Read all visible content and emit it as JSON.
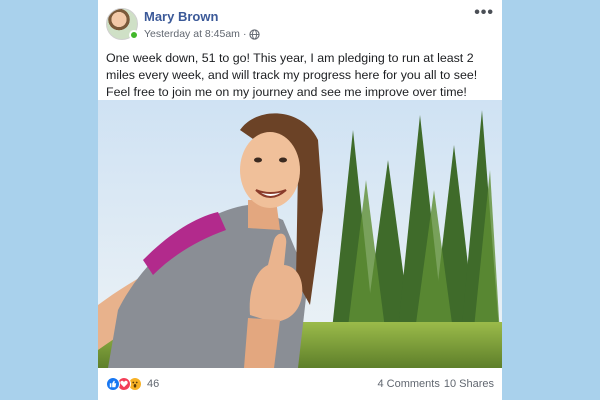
{
  "post": {
    "author": "Mary Brown",
    "timestamp": "Yesterday at 8:45am",
    "separator": "·",
    "privacy_icon": "globe-icon",
    "more_icon": "•••",
    "text": "One week down, 51 to go! This year, I am pledging to run at least 2 miles every week, and will track my progress here for you all to see! Feel free to join me on my journey and see me improve over time!",
    "photo_subject": "woman-running-selfie"
  },
  "footer": {
    "reactions": [
      "like-icon",
      "love-icon",
      "wow-icon"
    ],
    "reaction_count": "46",
    "comments": "4 Comments",
    "shares": "10 Shares"
  },
  "colors": {
    "background": "#a9d1ec",
    "name": "#3b5998",
    "online": "#42b72a",
    "like": "#1877f2",
    "love": "#f33e58",
    "wow": "#f7b125"
  }
}
